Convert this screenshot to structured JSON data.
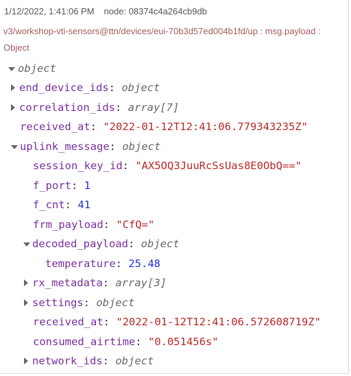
{
  "message": {
    "timestamp": "1/12/2022, 1:41:06 PM",
    "node": "node: 08374c4a264cb9db",
    "topic": "v3/workshop-vti-sensors@ttn/devices/eui-70b3d57ed004b1fd/up : msg.payload : Object"
  },
  "tree": {
    "root_type": "object",
    "end_device_ids": {
      "key": "end_device_ids",
      "type": "object"
    },
    "correlation_ids": {
      "key": "correlation_ids",
      "type": "array[7]"
    },
    "received_at": {
      "key": "received_at",
      "value": "\"2022-01-12T12:41:06.779343235Z\""
    },
    "uplink_message": {
      "key": "uplink_message",
      "type": "object",
      "session_key_id": {
        "key": "session_key_id",
        "value": "\"AX5OQ3JuuRcSsUas8E0ObQ==\""
      },
      "f_port": {
        "key": "f_port",
        "value": "1"
      },
      "f_cnt": {
        "key": "f_cnt",
        "value": "41"
      },
      "frm_payload": {
        "key": "frm_payload",
        "value": "\"CfQ=\""
      },
      "decoded_payload": {
        "key": "decoded_payload",
        "type": "object",
        "temperature": {
          "key": "temperature",
          "value": "25.48"
        }
      },
      "rx_metadata": {
        "key": "rx_metadata",
        "type": "array[3]"
      },
      "settings": {
        "key": "settings",
        "type": "object"
      },
      "received_at": {
        "key": "received_at",
        "value": "\"2022-01-12T12:41:06.572608719Z\""
      },
      "consumed_airtime": {
        "key": "consumed_airtime",
        "value": "\"0.051456s\""
      },
      "network_ids": {
        "key": "network_ids",
        "type": "object"
      }
    }
  }
}
